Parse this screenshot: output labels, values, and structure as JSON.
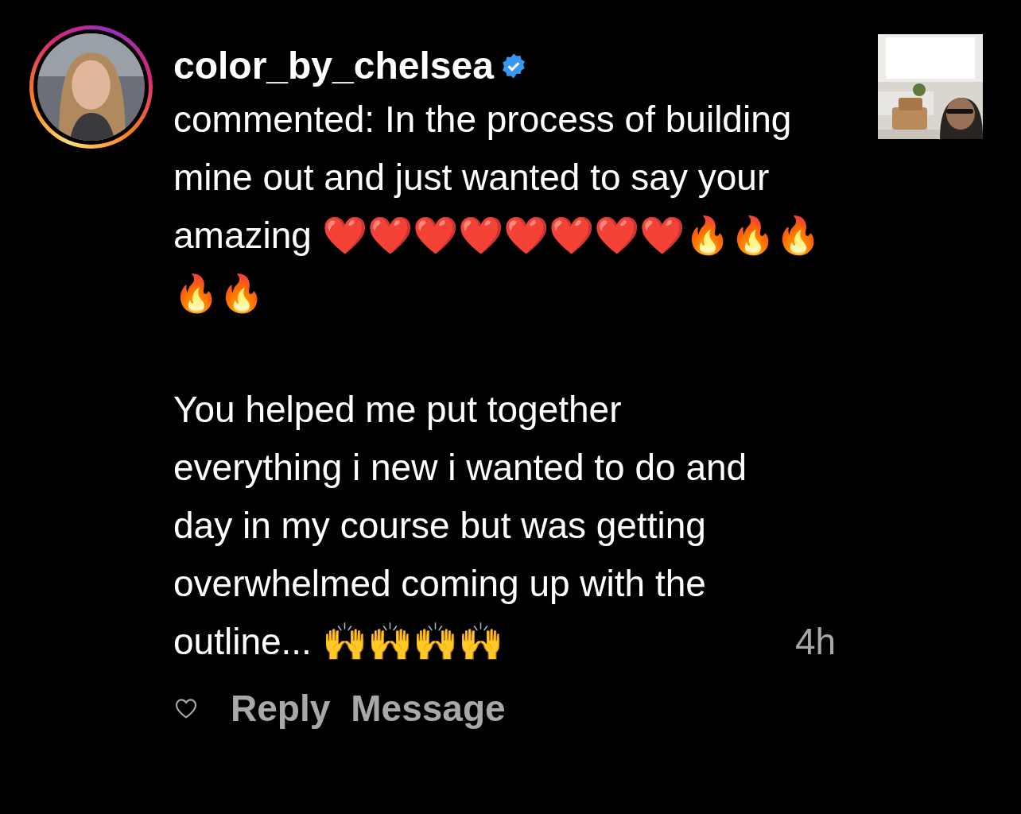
{
  "notification": {
    "username": "color_by_chelsea",
    "verified": true,
    "comment": [
      "commented: In the process of building mine out and just wanted to say your amazing ❤️❤️❤️❤️❤️❤️❤️❤️🔥🔥🔥🔥🔥",
      "You helped me put together everything i new i wanted to do and day in my course but was getting overwhelmed coming up with the outline... 🙌🙌🙌🙌"
    ],
    "time": "4h",
    "liked": false,
    "actions": [
      "Reply",
      "Message"
    ]
  }
}
